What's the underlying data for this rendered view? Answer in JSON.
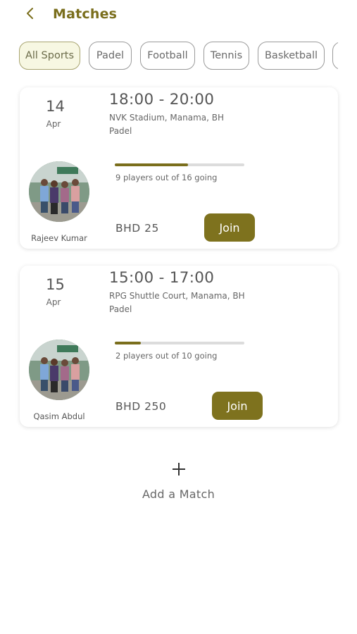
{
  "header": {
    "title": "Matches",
    "back_icon": "chevron-left-icon"
  },
  "filters": [
    {
      "label": "All Sports",
      "active": true
    },
    {
      "label": "Padel",
      "active": false
    },
    {
      "label": "Football",
      "active": false
    },
    {
      "label": "Tennis",
      "active": false
    },
    {
      "label": "Basketball",
      "active": false
    }
  ],
  "matches": [
    {
      "day": "14",
      "month": "Apr",
      "time": "18:00 - 20:00",
      "venue": "NVK Stadium, Manama, BH",
      "sport": "Padel",
      "players_going": 9,
      "players_total": 16,
      "progress": 0.5625,
      "going_text": "9 players out of 16 going",
      "price": "BHD 25",
      "join_label": "Join",
      "host": "Rajeev Kumar"
    },
    {
      "day": "15",
      "month": "Apr",
      "time": "15:00 - 17:00",
      "venue": "RPG Shuttle Court, Manama, BH",
      "sport": "Padel",
      "players_going": 2,
      "players_total": 10,
      "progress": 0.2,
      "going_text": "2 players out of 10 going",
      "price": "BHD 250",
      "join_label": "Join",
      "host": "Qasim Abdul"
    }
  ],
  "add_match": {
    "label": "Add a Match",
    "icon": "plus-icon"
  },
  "colors": {
    "accent": "#7e721e",
    "title": "#7a6e1c",
    "chip_active_bg": "#f7f7e2",
    "track": "#dcdcdc"
  }
}
